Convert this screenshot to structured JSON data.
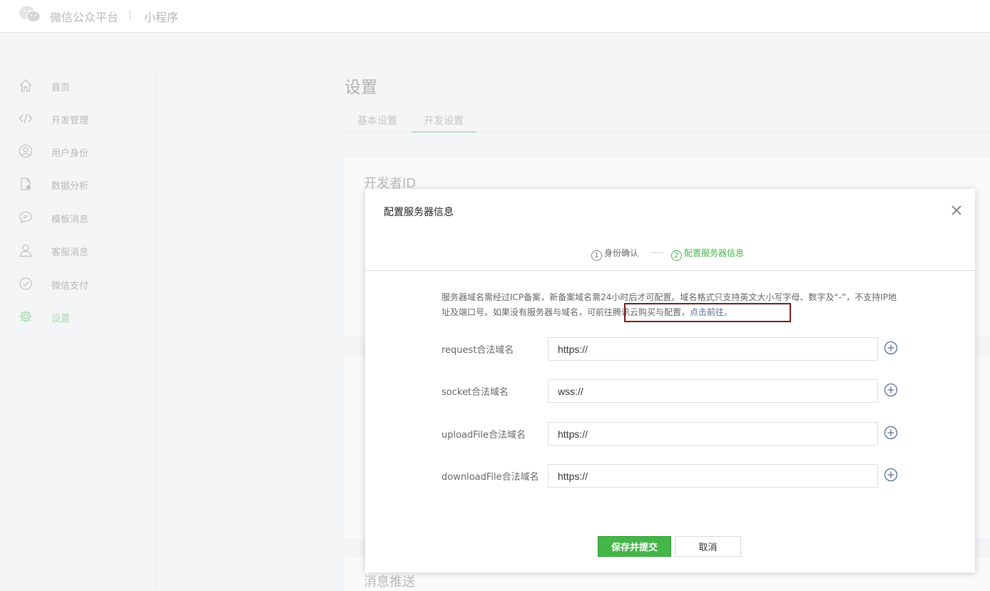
{
  "header": {
    "brand": "微信公众平台",
    "separator": "|",
    "product": "小程序"
  },
  "sidebar": {
    "items": [
      {
        "label": "首页",
        "icon": "home-icon"
      },
      {
        "label": "开发管理",
        "icon": "code-icon"
      },
      {
        "label": "用户身份",
        "icon": "user-circle-icon"
      },
      {
        "label": "数据分析",
        "icon": "document-chart-icon"
      },
      {
        "label": "模板消息",
        "icon": "chat-bubble-icon"
      },
      {
        "label": "客服消息",
        "icon": "customer-service-icon"
      },
      {
        "label": "微信支付",
        "icon": "payment-icon"
      },
      {
        "label": "设置",
        "icon": "gear-icon",
        "active": true
      }
    ]
  },
  "page": {
    "title": "设置",
    "tabs": [
      "基本设置",
      "开发设置"
    ],
    "active_tab": "开发设置",
    "sections": [
      "开发者ID",
      "消息推送"
    ]
  },
  "modal": {
    "title": "配置服务器信息",
    "close_icon": "close-icon",
    "steps": [
      {
        "num": "1",
        "label": "身份确认",
        "active": false
      },
      {
        "num": "2",
        "label": "配置服务器信息",
        "active": true
      }
    ],
    "notice": {
      "text": "服务器域名需经过ICP备案，新备案域名需24小时后才可配置。域名格式只支持英文大小写字母、数字及“-”，不支持IP地址及端口号。如果没有服务器与域名，",
      "highlight": "可前往腾讯云购买与配置，",
      "link": "点击前往。"
    },
    "fields": [
      {
        "label": "request合法域名",
        "value": "https://"
      },
      {
        "label": "socket合法域名",
        "value": "wss://"
      },
      {
        "label": "uploadFile合法域名",
        "value": "https://"
      },
      {
        "label": "downloadFile合法域名",
        "value": "https://"
      }
    ],
    "buttons": {
      "submit": "保存并提交",
      "cancel": "取消"
    }
  },
  "colors": {
    "primary": "#44b549",
    "link": "#576b95",
    "highlight_box": "#7a1a1a"
  }
}
